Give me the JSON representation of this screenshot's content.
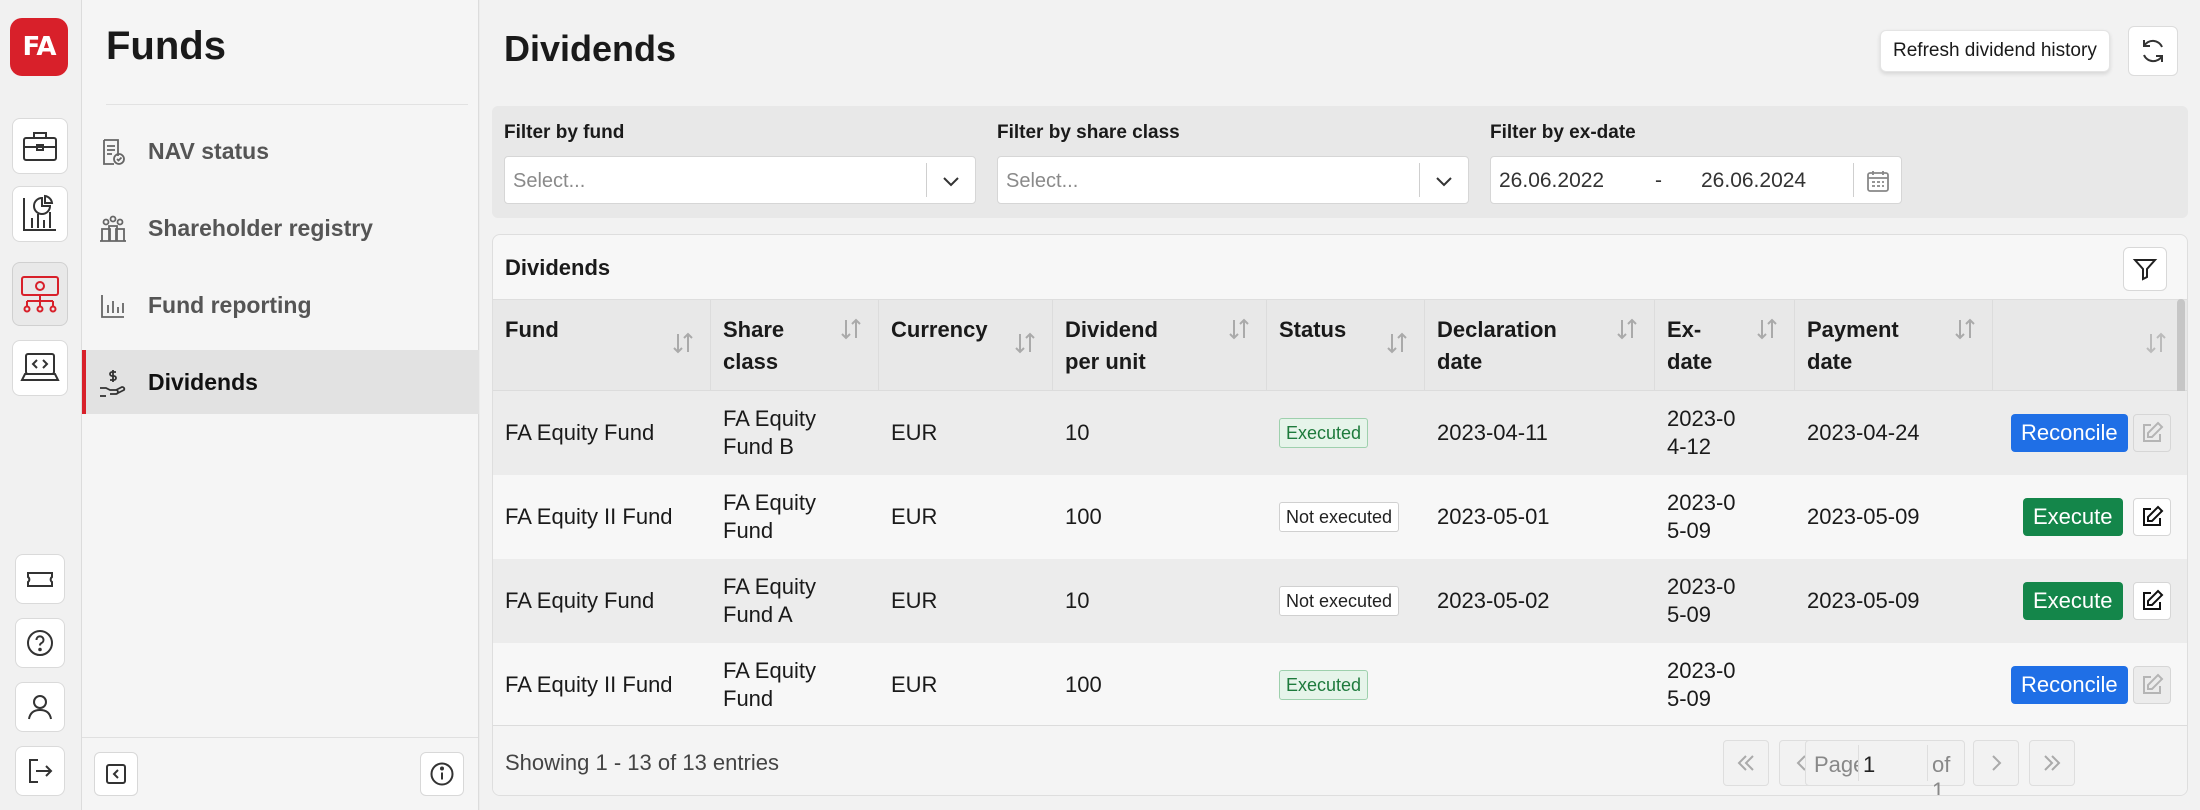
{
  "app": {
    "logo_text": "FA"
  },
  "rail": {
    "items": [
      "briefcase-icon",
      "chart-report-icon",
      "funds-icon",
      "code-laptop-icon"
    ],
    "bottom_items": [
      "ticket-icon",
      "help-icon",
      "user-icon",
      "logout-icon"
    ]
  },
  "sidebar": {
    "title": "Funds",
    "items": [
      {
        "label": "NAV status",
        "icon": "nav-status-icon"
      },
      {
        "label": "Shareholder registry",
        "icon": "shareholder-icon"
      },
      {
        "label": "Fund reporting",
        "icon": "bar-chart-icon"
      },
      {
        "label": "Dividends",
        "icon": "dividend-hand-icon",
        "active": true
      }
    ]
  },
  "main": {
    "title": "Dividends",
    "refresh_tooltip": "Refresh dividend history"
  },
  "filters": {
    "fund": {
      "label": "Filter by fund",
      "placeholder": "Select..."
    },
    "share_class": {
      "label": "Filter by share class",
      "placeholder": "Select..."
    },
    "ex_date": {
      "label": "Filter by ex-date",
      "from": "26.06.2022",
      "separator": "-",
      "to": "26.06.2024"
    }
  },
  "table": {
    "title": "Dividends",
    "columns": [
      {
        "label": "Fund"
      },
      {
        "label": "Share class"
      },
      {
        "label": "Currency"
      },
      {
        "label": "Dividend per unit"
      },
      {
        "label": "Status"
      },
      {
        "label": "Declaration date"
      },
      {
        "label": "Ex-date"
      },
      {
        "label": "Payment date"
      },
      {
        "label": ""
      }
    ],
    "rows": [
      {
        "fund": "FA Equity Fund",
        "share_class": "FA Equity Fund B",
        "currency": "EUR",
        "dividend": "10",
        "status": "Executed",
        "declaration": "2023-04-11",
        "ex_date": "2023-04-12",
        "payment": "2023-04-24",
        "action": "Reconcile"
      },
      {
        "fund": "FA Equity II Fund",
        "share_class": "FA Equity Fund",
        "currency": "EUR",
        "dividend": "100",
        "status": "Not executed",
        "declaration": "2023-05-01",
        "ex_date": "2023-05-09",
        "payment": "2023-05-09",
        "action": "Execute"
      },
      {
        "fund": "FA Equity Fund",
        "share_class": "FA Equity Fund A",
        "currency": "EUR",
        "dividend": "10",
        "status": "Not executed",
        "declaration": "2023-05-02",
        "ex_date": "2023-05-09",
        "payment": "2023-05-09",
        "action": "Execute"
      },
      {
        "fund": "FA Equity II Fund",
        "share_class": "FA Equity Fund",
        "currency": "EUR",
        "dividend": "100",
        "status": "Executed",
        "declaration": "",
        "ex_date": "2023-05-09",
        "payment": "",
        "action": "Reconcile"
      }
    ]
  },
  "pagination": {
    "summary": "Showing 1 - 13 of 13 entries",
    "page_label": "Page",
    "page_value": "1",
    "of_label": "of 1"
  },
  "colors": {
    "brand": "#d8202a",
    "reconcile": "#1f6fe6",
    "execute": "#14864a",
    "executed_badge": "#e6f4ea"
  }
}
